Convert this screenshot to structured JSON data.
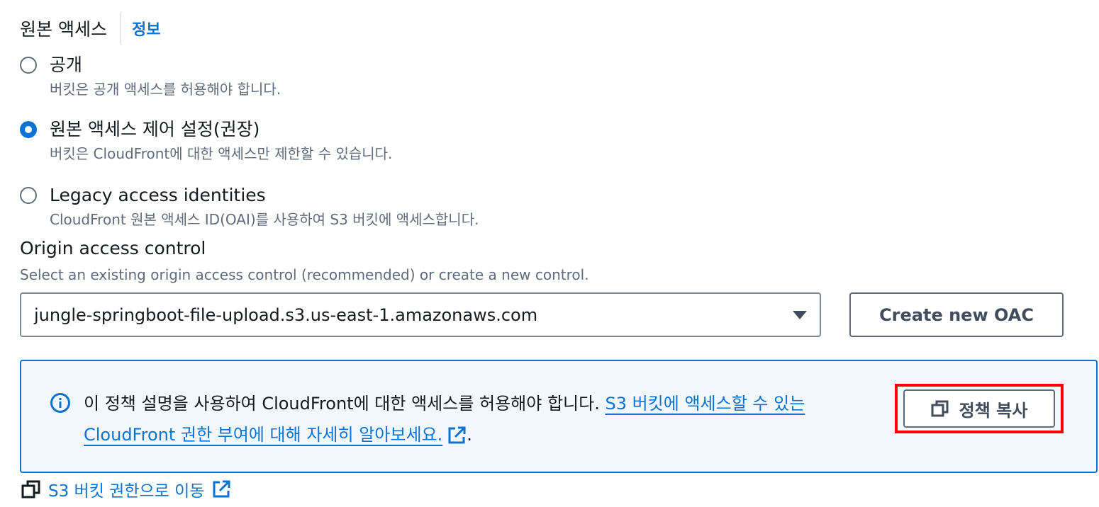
{
  "header": {
    "title": "원본 액세스",
    "info_link": "정보"
  },
  "origin_access": {
    "options": [
      {
        "label": "공개",
        "description": "버킷은 공개 액세스를 허용해야 합니다.",
        "selected": false
      },
      {
        "label": "원본 액세스 제어 설정(권장)",
        "description": "버킷은 CloudFront에 대한 액세스만 제한할 수 있습니다.",
        "selected": true
      },
      {
        "label": "Legacy access identities",
        "description": "CloudFront 원본 액세스 ID(OAI)를 사용하여 S3 버킷에 액세스합니다.",
        "selected": false
      }
    ]
  },
  "oac": {
    "label": "Origin access control",
    "description": "Select an existing origin access control (recommended) or create a new control.",
    "selected_value": "jungle-springboot-file-upload.s3.us-east-1.amazonaws.com",
    "create_button": "Create new OAC"
  },
  "alert": {
    "text": "이 정책 설명을 사용하여 CloudFront에 대한 액세스를 허용해야 합니다. ",
    "link_text": "S3 버킷에 액세스할 수 있는 CloudFront 권한 부여에 대해 자세히 알아보세요.",
    "trailing": ".",
    "copy_button": "정책 복사",
    "icon": "info-icon"
  },
  "bottom_link": {
    "text": "S3 버킷 권한으로 이동",
    "icon": "copy-icon",
    "trailing_icon": "external-link-icon"
  },
  "colors": {
    "accent": "#0972d3",
    "highlight": "#ff0000",
    "alert_bg": "#f2f8fd"
  }
}
